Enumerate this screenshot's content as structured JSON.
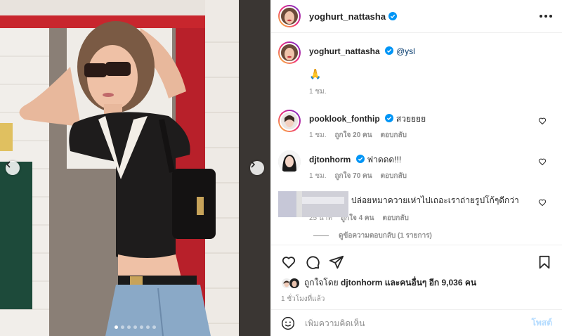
{
  "post": {
    "author": "yoghurt_nattasha",
    "more_icon": "more-horizontal-icon",
    "caption_mention": "@ysl",
    "caption_emoji": "🙏",
    "caption_time": "1 ชม.",
    "carousel": {
      "total_slides": 7,
      "active_slide": 1
    }
  },
  "comments": [
    {
      "user": "pooklook_fonthip",
      "text": "สวยยยย",
      "time": "1 ชม.",
      "likes": "ถูกใจ 20 คน",
      "reply": "ตอบกลับ",
      "verified": true
    },
    {
      "user": "djtonhorm",
      "text": "ฟาดดด!!!",
      "time": "1 ชม.",
      "likes": "ถูกใจ 70 คน",
      "reply": "ตอบกลับ",
      "verified": true
    },
    {
      "user": "",
      "text": "ปล่อยหมาควายเห่าไปเถอะเราถ่ายรูปโก้ๆดีกว่า",
      "time": "25 นาที",
      "likes": "ถูกใจ 4 คน",
      "reply": "ตอบกลับ",
      "verified": false
    }
  ],
  "view_replies": "ดูข้อความตอบกลับ (1 รายการ)",
  "liked_by": {
    "prefix": "ถูกใจโดย",
    "user": "djtonhorm",
    "middle": "และคนอื่นๆ",
    "count": "อีก 9,036 คน"
  },
  "time_ago": "1 ชั่วโมงที่แล้ว",
  "comment_box": {
    "placeholder": "เพิ่มความคิดเห็น",
    "post_label": "โพสต์"
  },
  "colors": {
    "verified": "#0095f6",
    "post_disabled": "#b3dbff"
  }
}
